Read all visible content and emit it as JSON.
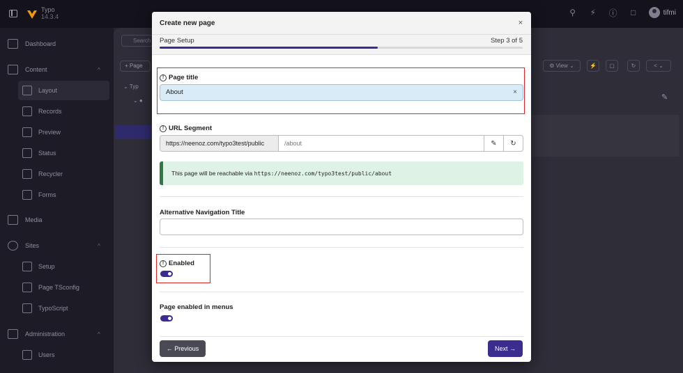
{
  "topbar": {
    "brand_name": "Typo",
    "version": "14.3.4",
    "user_name": "tifmi"
  },
  "sidebar": {
    "items": [
      {
        "label": "Dashboard",
        "icon": "dashboard-icon"
      },
      {
        "label": "Content",
        "icon": "content-icon",
        "chevron": "^"
      },
      {
        "label": "Layout",
        "icon": "layout-icon"
      },
      {
        "label": "Records",
        "icon": "records-icon"
      },
      {
        "label": "Preview",
        "icon": "preview-icon"
      },
      {
        "label": "Status",
        "icon": "status-icon"
      },
      {
        "label": "Recycler",
        "icon": "recycler-icon"
      },
      {
        "label": "Forms",
        "icon": "forms-icon"
      },
      {
        "label": "Media",
        "icon": "media-icon"
      },
      {
        "label": "Sites",
        "icon": "sites-icon",
        "chevron": "^"
      },
      {
        "label": "Setup",
        "icon": "setup-icon"
      },
      {
        "label": "Page TSconfig",
        "icon": "tsconfig-icon"
      },
      {
        "label": "TypoScript",
        "icon": "typoscript-icon"
      },
      {
        "label": "Administration",
        "icon": "administration-icon",
        "chevron": "^"
      },
      {
        "label": "Users",
        "icon": "users-icon"
      }
    ]
  },
  "background": {
    "search_placeholder": "Search",
    "page_button": "+ Page",
    "tree_label": "Typ",
    "view_button": "View"
  },
  "modal": {
    "title": "Create new page",
    "close": "×",
    "step_label": "Page Setup",
    "step_count": "Step 3 of 5",
    "progress": 0.6,
    "page_title": {
      "label": "Page title",
      "value": "About",
      "clear": "×"
    },
    "url_segment": {
      "label": "URL Segment",
      "prefix": "https://neenoz.com/typo3test/public",
      "value": "/about"
    },
    "callout": {
      "text": "This page will be reachable via ",
      "url": "https://neenoz.com/typo3test/public/about"
    },
    "nav_title": {
      "label": "Alternative Navigation Title",
      "value": ""
    },
    "enabled": {
      "label": "Enabled",
      "on": true
    },
    "menus": {
      "label": "Page enabled in menus",
      "on": true
    },
    "prev_button": "← Previous",
    "next_button": "Next →"
  },
  "colors": {
    "accent": "#3b2c8f",
    "highlight": "#e02424",
    "callout_bg": "#dff2e6",
    "active_input_bg": "#d8ebf6"
  }
}
